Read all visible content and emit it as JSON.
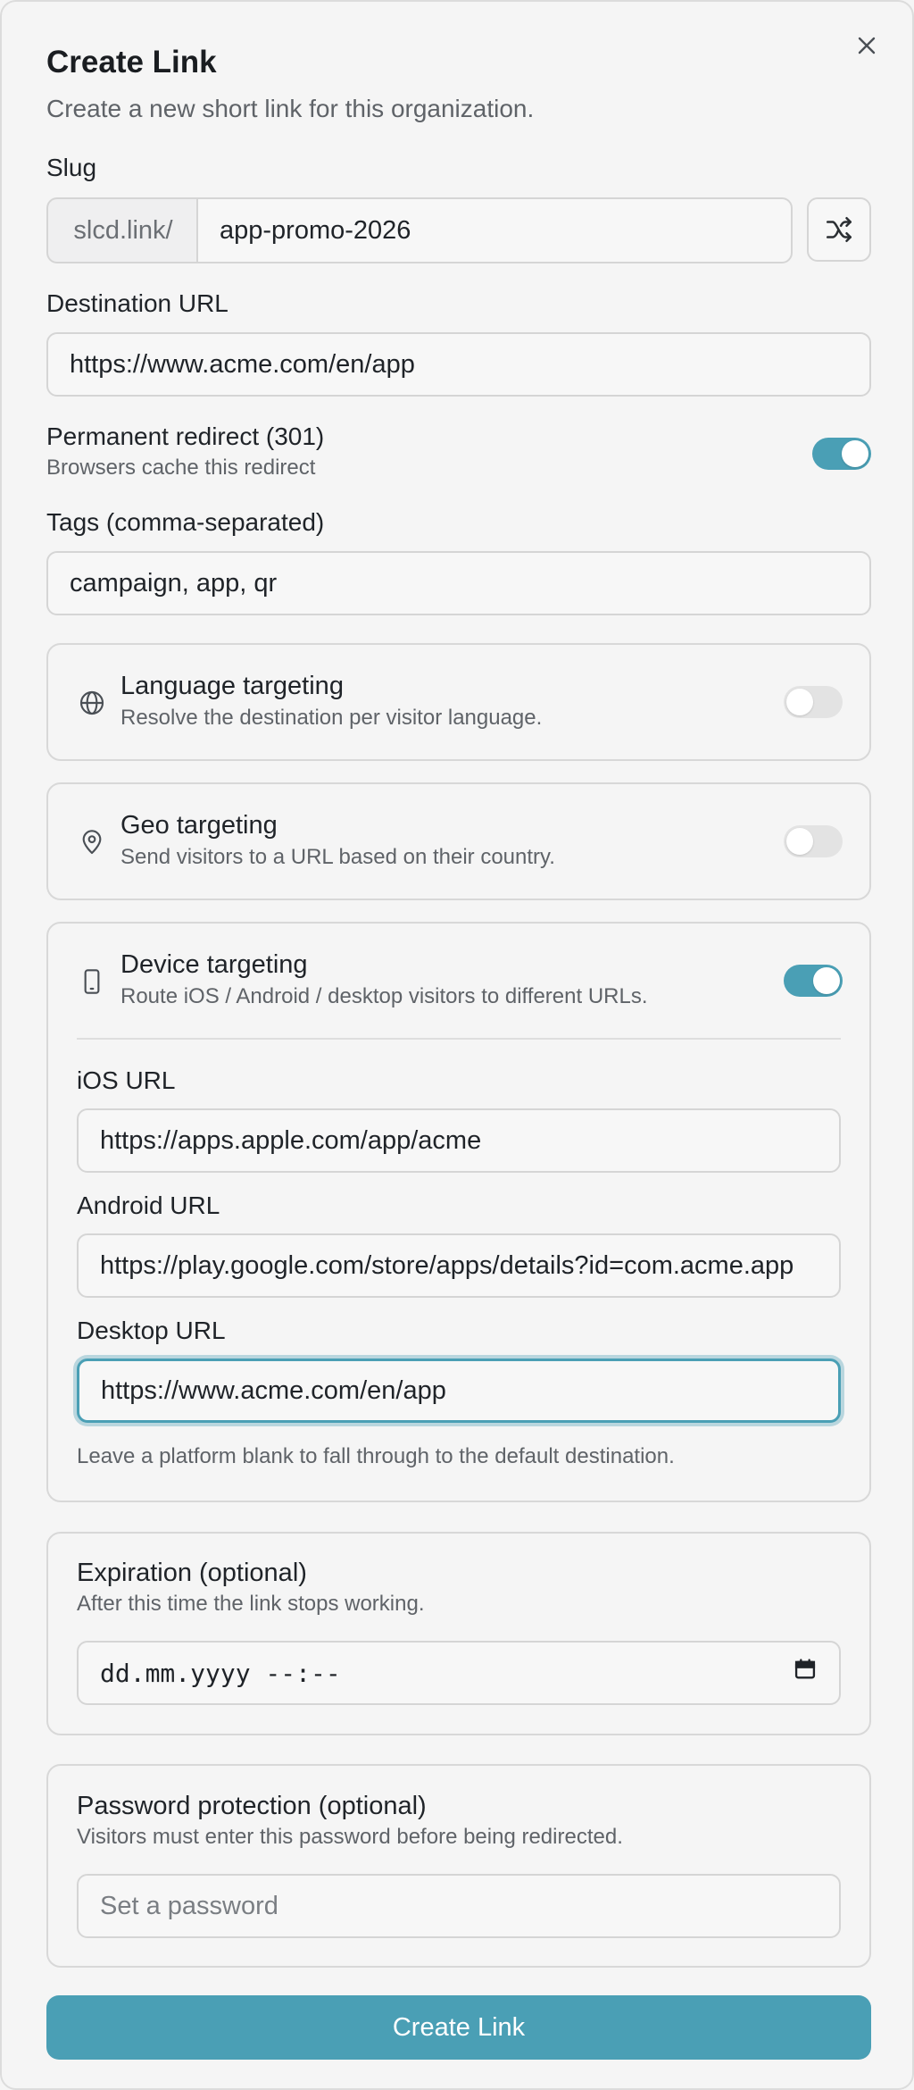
{
  "dialog": {
    "title": "Create Link",
    "subtitle": "Create a new short link for this organization.",
    "close_icon": "close-icon"
  },
  "slug": {
    "label": "Slug",
    "prefix": "slcd.link/",
    "value": "app-promo-2026",
    "shuffle_icon": "shuffle-icon"
  },
  "destination": {
    "label": "Destination URL",
    "value": "https://www.acme.com/en/app"
  },
  "permanent_redirect": {
    "label": "Permanent redirect (301)",
    "description": "Browsers cache this redirect",
    "enabled": true
  },
  "tags": {
    "label": "Tags (comma-separated)",
    "value": "campaign, app, qr"
  },
  "language_targeting": {
    "icon": "globe-icon",
    "title": "Language targeting",
    "description": "Resolve the destination per visitor language.",
    "enabled": false
  },
  "geo_targeting": {
    "icon": "map-pin-icon",
    "title": "Geo targeting",
    "description": "Send visitors to a URL based on their country.",
    "enabled": false
  },
  "device_targeting": {
    "icon": "smartphone-icon",
    "title": "Device targeting",
    "description": "Route iOS / Android / desktop visitors to different URLs.",
    "enabled": true,
    "ios_label": "iOS URL",
    "ios_value": "https://apps.apple.com/app/acme",
    "android_label": "Android URL",
    "android_value": "https://play.google.com/store/apps/details?id=com.acme.app",
    "desktop_label": "Desktop URL",
    "desktop_value": "https://www.acme.com/en/app",
    "hint": "Leave a platform blank to fall through to the default destination."
  },
  "expiration": {
    "title": "Expiration (optional)",
    "description": "After this time the link stops working.",
    "placeholder": "dd.mm.yyyy --:--",
    "calendar_icon": "calendar-icon"
  },
  "password": {
    "title": "Password protection (optional)",
    "description": "Visitors must enter this password before being redirected.",
    "placeholder": "Set a password"
  },
  "submit_label": "Create Link",
  "colors": {
    "accent": "#4a9fb5",
    "toggle_off": "#e3e3e3",
    "border": "#d5d5d5",
    "background": "#f5f5f5"
  }
}
